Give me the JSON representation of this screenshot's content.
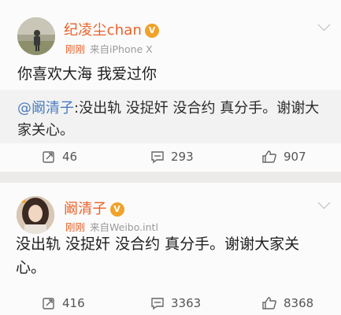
{
  "posts": [
    {
      "author": "纪凌尘chan",
      "time": "刚刚",
      "source": "来自iPhone X",
      "text": "你喜欢大海 我爱过你",
      "quote": {
        "mention": "@阚清子",
        "text": ":没出轨 没捉奸 没合约 真分手。谢谢大家关心。"
      },
      "reposts": "46",
      "comments": "293",
      "likes": "907"
    },
    {
      "author": "阚清子",
      "time": "刚刚",
      "source": "来自Weibo.intl",
      "text": "没出轨 没捉奸 没合约 真分手。谢谢大家关心。",
      "reposts": "416",
      "comments": "3363",
      "likes": "8368"
    }
  ],
  "icons": {
    "repost": "repost-icon",
    "comment": "comment-icon",
    "like": "like-icon",
    "vip": "vip-badge-icon",
    "more": "chevron-down-icon"
  },
  "colors": {
    "name": "#e8622a",
    "mention": "#4a7bbf",
    "background": "#ecebe9",
    "card": "#fbfbfb"
  }
}
